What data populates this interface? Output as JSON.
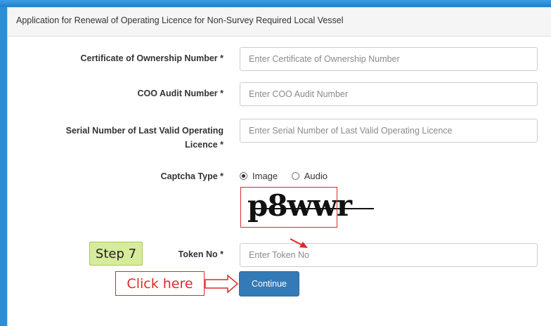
{
  "form": {
    "title": "Application for Renewal of Operating Licence for Non-Survey Required Local Vessel",
    "fields": [
      {
        "label": "Certificate of Ownership Number *",
        "placeholder": "Enter Certificate of Ownership Number"
      },
      {
        "label": "COO Audit Number *",
        "placeholder": "Enter COO Audit Number"
      },
      {
        "label_line1": "Serial Number of Last Valid Operating",
        "label_line2": "Licence *",
        "placeholder": "Enter Serial Number of Last Valid Operating Licence"
      }
    ],
    "captcha_type": {
      "label": "Captcha Type *",
      "options": [
        "Image",
        "Audio"
      ],
      "selected": "Image"
    },
    "captcha_text": "p8wwr",
    "token": {
      "label": "Token No *",
      "placeholder": "Enter Token No"
    },
    "continue_label": "Continue"
  },
  "annotations": {
    "step_label": "Step 7",
    "click_here": "Click here",
    "highlight_color": "#e0282a"
  }
}
